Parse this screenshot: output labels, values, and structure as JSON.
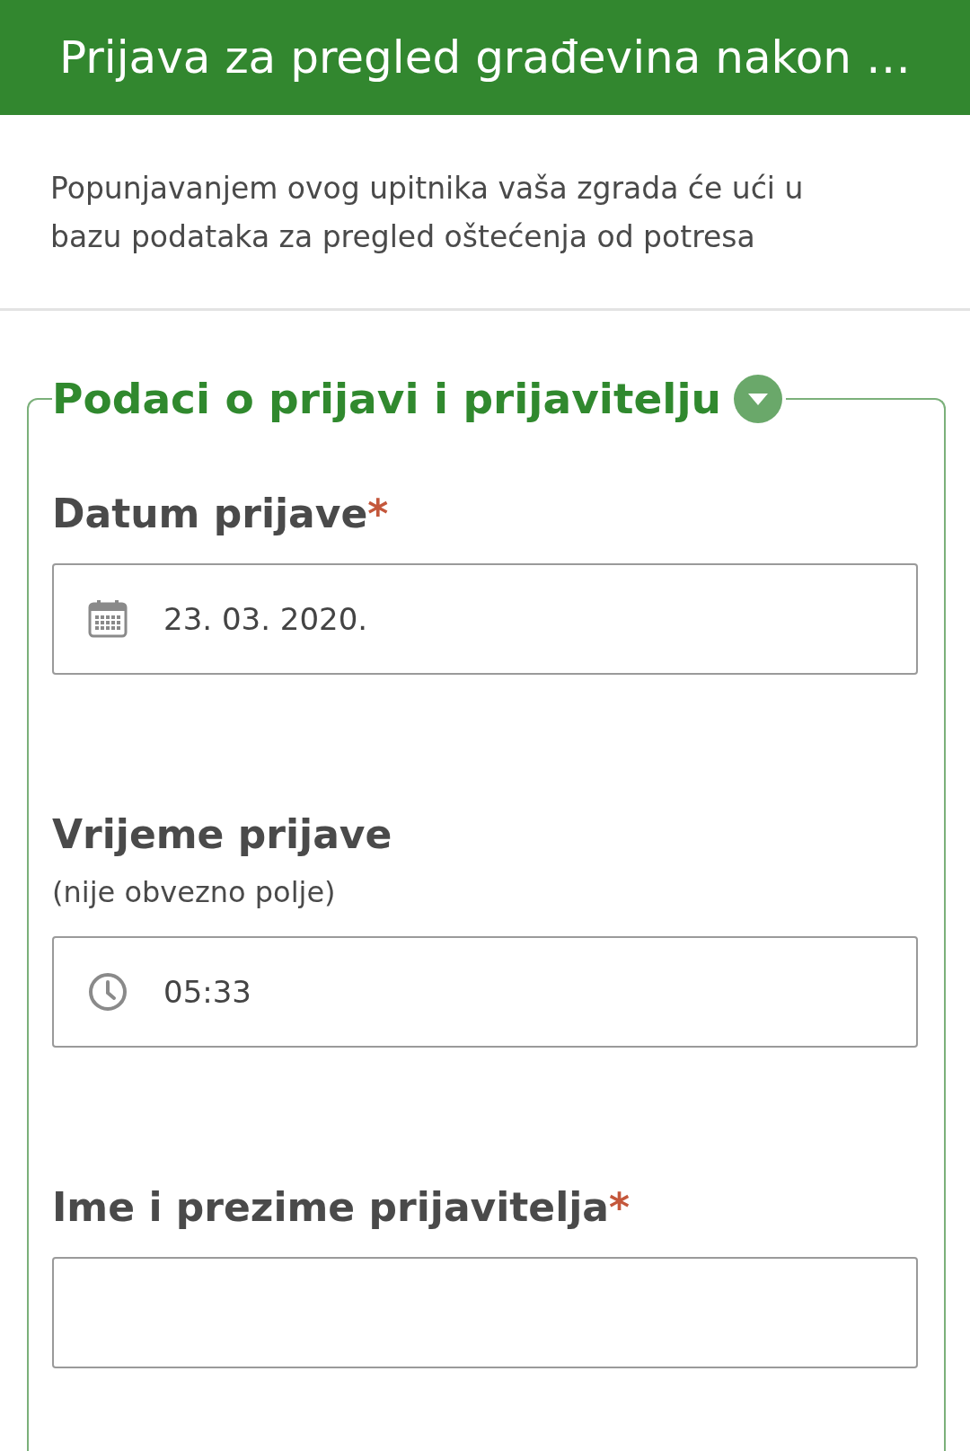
{
  "header": {
    "title": "Prijava za pregled građevina nakon …"
  },
  "description": "Popunjavanjem ovog upitnika vaša zgrada će ući u bazu podataka za pregled oštećenja od potresa",
  "section": {
    "title": "Podaci o prijavi i prijavitelju",
    "expanded": true,
    "fields": [
      {
        "kind": "date",
        "label": "Datum prijave",
        "required_mark": "*",
        "value": "23. 03. 2020."
      },
      {
        "kind": "time",
        "label": "Vrijeme prijave",
        "hint": "(nije obvezno polje)",
        "value": "05:33"
      },
      {
        "kind": "text",
        "label": "Ime i prezime prijavitelja",
        "required_mark": "*"
      }
    ]
  }
}
